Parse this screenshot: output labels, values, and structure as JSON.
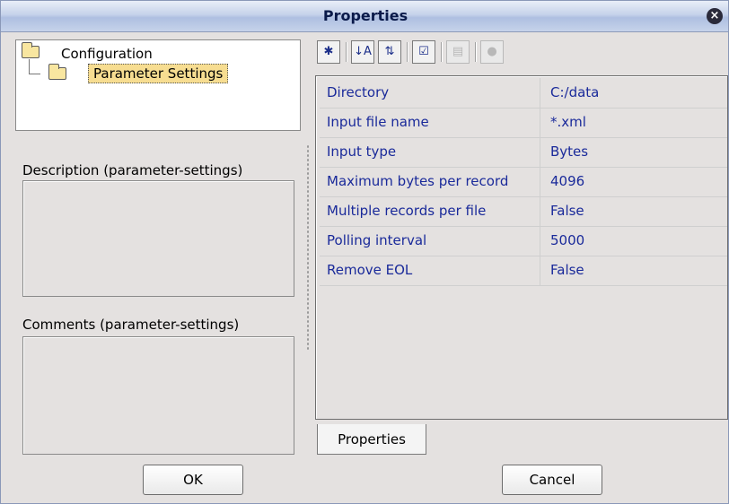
{
  "window": {
    "title": "Properties",
    "close_icon": "close-icon"
  },
  "tree": {
    "root_label": "Configuration",
    "child_label": "Parameter Settings"
  },
  "description": {
    "label": "Description (parameter-settings)",
    "value": ""
  },
  "comments": {
    "label": "Comments (parameter-settings)",
    "value": ""
  },
  "toolbar": {
    "buttons": [
      {
        "name": "pin-icon",
        "glyph": "✱",
        "enabled": true
      },
      {
        "name": "sort-alpha-icon",
        "glyph": "↓A",
        "enabled": true
      },
      {
        "name": "sort-category-icon",
        "glyph": "⇅",
        "enabled": true
      },
      {
        "name": "checklist-icon",
        "glyph": "☑",
        "enabled": true
      },
      {
        "name": "edit-icon",
        "glyph": "▤",
        "enabled": false
      },
      {
        "name": "help-icon",
        "glyph": "●",
        "enabled": false
      }
    ]
  },
  "properties": [
    {
      "name": "Directory",
      "value": "C:/data"
    },
    {
      "name": "Input file name",
      "value": "*.xml"
    },
    {
      "name": "Input type",
      "value": "Bytes"
    },
    {
      "name": "Maximum bytes per record",
      "value": "4096"
    },
    {
      "name": "Multiple records per file",
      "value": "False"
    },
    {
      "name": "Polling interval",
      "value": "5000"
    },
    {
      "name": "Remove EOL",
      "value": "False"
    }
  ],
  "tab_label": "Properties",
  "buttons": {
    "ok": "OK",
    "cancel": "Cancel"
  }
}
